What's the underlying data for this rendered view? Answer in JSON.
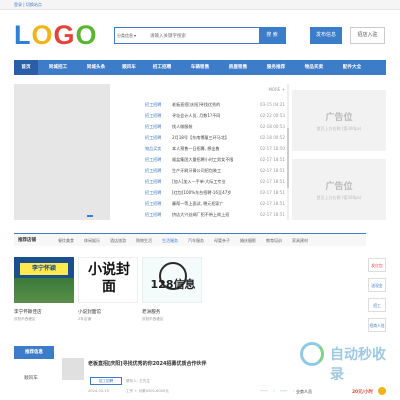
{
  "topbar": {
    "links": "登录 | 切换站点"
  },
  "logo": {
    "l1": "L",
    "l2": "O",
    "l3": "G",
    "l4": "O"
  },
  "search": {
    "category": "分类信息",
    "placeholder": "请输入关键字搜索",
    "button": "搜 索"
  },
  "header": {
    "post_button": "发布信息",
    "store_button": "招店入驻"
  },
  "nav": [
    "首页",
    "同城招工",
    "同城头条",
    "顺风车",
    "招工招聘",
    "车辆租售",
    "房屋租售",
    "服务推荐",
    "物品买卖",
    "配件大全"
  ],
  "news": {
    "more": "MORE +",
    "rows": [
      {
        "tag": "招工招聘",
        "title": "老板直招[庆阳]寻找优秀的",
        "date": "03-15 04:21"
      },
      {
        "tag": "招工招聘",
        "title": "寻址会计人员, 月数1?不同",
        "date": "02-22 00:53"
      },
      {
        "tag": "招工招聘",
        "title": "找人做服装",
        "date": "02-18 00:53"
      },
      {
        "tag": "招工招聘",
        "title": "2月18号【东南博厦三环马北】",
        "date": "02-18 00:52"
      },
      {
        "tag": "物品买卖",
        "title": "本人预售一日招募, 想出售",
        "date": "02-17 18:50"
      },
      {
        "tag": "招工招聘",
        "title": "顺盆集团大量招聘小时工男女不限",
        "date": "02-17 18:51"
      },
      {
        "tag": "招工招聘",
        "title": "生产牙刷牙膏公司招包装工",
        "date": "02-17 18:51"
      },
      {
        "tag": "招工招聘",
        "title": "[加人]加入一手单·大际工专业",
        "date": "02-17 18:51"
      },
      {
        "tag": "招工招聘",
        "title": "[红包]100%东台招聘·16至47岁",
        "date": "02-17 18:51"
      },
      {
        "tag": "招工招聘",
        "title": "廉帮一等上面试, 晚元招家广",
        "date": "02-17 18:51"
      },
      {
        "tag": "招工招聘",
        "title": "挤店大兴丝绸厂招不带上岗上班",
        "date": "02-17 18:51"
      }
    ]
  },
  "ads": [
    {
      "title": "广告位",
      "sub": "首页上方右侧 (宽300px)"
    },
    {
      "title": "广告位",
      "sub": "首页上方右侧 (宽300px)"
    }
  ],
  "store_strip": {
    "heading": "推荐店铺",
    "cats": [
      "餐饮美食",
      "休闲娱乐",
      "酒店旅游",
      "购物生活",
      "生活服务",
      "汽车服务",
      "母婴亲子",
      "婚庆摄影",
      "教育培训",
      "家具建材"
    ]
  },
  "stores": [
    {
      "sign": "李宁怀颖",
      "name": "李宁怀颖佳店",
      "meta": "庆阳市西峰区",
      "grade": ""
    },
    {
      "big": "小说封面",
      "name": "小说封面馆",
      "meta": "2年店铺",
      "grade": ""
    },
    {
      "big": "128信息",
      "name": "老洲服务",
      "meta": "庆阳市西峰区",
      "grade": ""
    }
  ],
  "side": [
    {
      "label": "发红包",
      "red": true
    },
    {
      "label": "送现金",
      "red": false
    },
    {
      "label": "招工",
      "red": false
    },
    {
      "label": "招商人驻",
      "red": false
    }
  ],
  "bottom": {
    "section_title": "推荐信息",
    "category": "顺风车",
    "headline": "老板直招[庆阳]寻找优秀的你2024招募优质合作伙伴",
    "tag": "招工招聘",
    "sub": "联系人: 王先生",
    "date": "2024-03-15",
    "salary": "工作 + 月薪4500-6000元",
    "vip": "业务人员",
    "price": "20元/小时"
  },
  "watermark": {
    "text": "自动秒收录",
    "sub": "一 · 一 · 一"
  }
}
